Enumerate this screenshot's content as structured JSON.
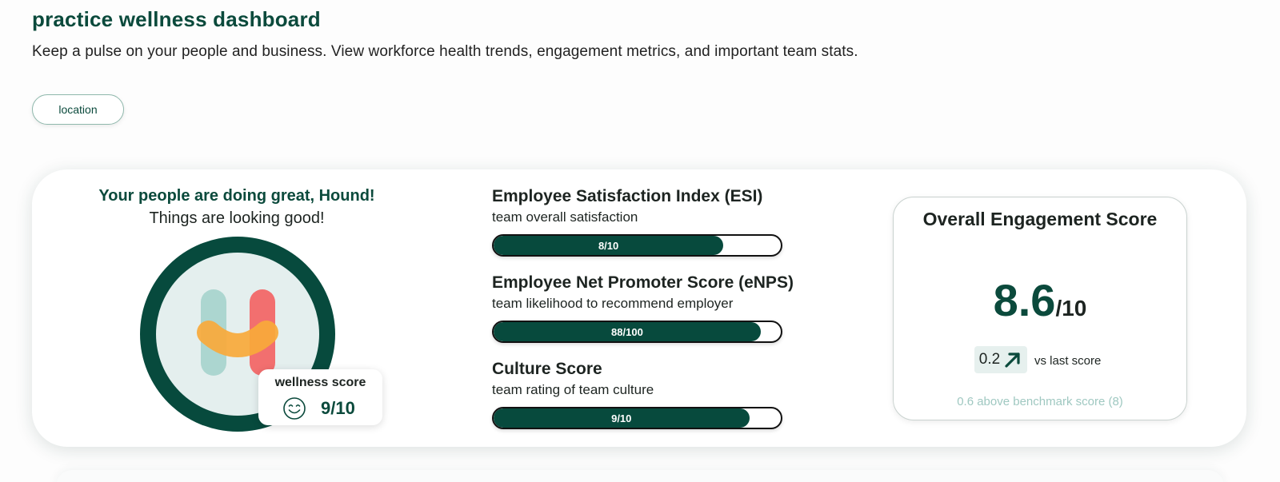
{
  "header": {
    "title": "practice wellness dashboard",
    "subtitle": "Keep a pulse on your people and business. View workforce health trends, engagement metrics, and important team stats."
  },
  "filters": {
    "location_label": "location"
  },
  "wellness": {
    "greeting": "Your people are doing great, Hound!",
    "message": "Things are looking good!",
    "badge_label": "wellness score",
    "score": "9/10",
    "icon": "smile-icon",
    "logo_icon": "h-logo-icon"
  },
  "metrics": [
    {
      "title": "Employee Satisfaction Index (ESI)",
      "subtitle": "team overall satisfaction",
      "label": "8/10",
      "fraction": 0.8
    },
    {
      "title": "Employee Net Promoter Score (eNPS)",
      "subtitle": "team likelihood to recommend employer",
      "label": "88/100",
      "fraction": 0.93
    },
    {
      "title": "Culture Score",
      "subtitle": "team rating of team culture",
      "label": "9/10",
      "fraction": 0.89
    }
  ],
  "engagement": {
    "title": "Overall Engagement Score",
    "score": "8.6",
    "out_of": "/10",
    "delta": "0.2",
    "delta_icon": "arrow-up-right-icon",
    "vs_label": "vs last score",
    "benchmark": "0.6 above benchmark score (8)"
  },
  "colors": {
    "brand_dark": "#074a3d",
    "bar_border": "#111111",
    "logo_mint": "#a9d4cd",
    "logo_coral": "#f26f6f",
    "logo_orange": "#f8a93a",
    "benchmark_text": "#9fc8c1"
  }
}
